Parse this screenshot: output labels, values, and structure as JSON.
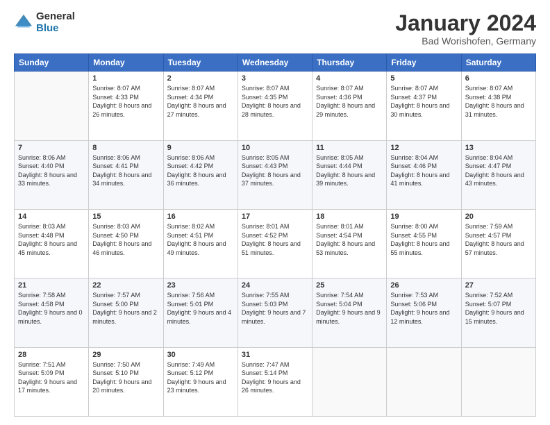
{
  "logo": {
    "general": "General",
    "blue": "Blue"
  },
  "title": "January 2024",
  "location": "Bad Worishofen, Germany",
  "weekdays": [
    "Sunday",
    "Monday",
    "Tuesday",
    "Wednesday",
    "Thursday",
    "Friday",
    "Saturday"
  ],
  "weeks": [
    [
      {
        "day": "",
        "sunrise": "",
        "sunset": "",
        "daylight": ""
      },
      {
        "day": "1",
        "sunrise": "8:07 AM",
        "sunset": "4:33 PM",
        "daylight": "8 hours and 26 minutes."
      },
      {
        "day": "2",
        "sunrise": "8:07 AM",
        "sunset": "4:34 PM",
        "daylight": "8 hours and 27 minutes."
      },
      {
        "day": "3",
        "sunrise": "8:07 AM",
        "sunset": "4:35 PM",
        "daylight": "8 hours and 28 minutes."
      },
      {
        "day": "4",
        "sunrise": "8:07 AM",
        "sunset": "4:36 PM",
        "daylight": "8 hours and 29 minutes."
      },
      {
        "day": "5",
        "sunrise": "8:07 AM",
        "sunset": "4:37 PM",
        "daylight": "8 hours and 30 minutes."
      },
      {
        "day": "6",
        "sunrise": "8:07 AM",
        "sunset": "4:38 PM",
        "daylight": "8 hours and 31 minutes."
      }
    ],
    [
      {
        "day": "7",
        "sunrise": "8:06 AM",
        "sunset": "4:40 PM",
        "daylight": "8 hours and 33 minutes."
      },
      {
        "day": "8",
        "sunrise": "8:06 AM",
        "sunset": "4:41 PM",
        "daylight": "8 hours and 34 minutes."
      },
      {
        "day": "9",
        "sunrise": "8:06 AM",
        "sunset": "4:42 PM",
        "daylight": "8 hours and 36 minutes."
      },
      {
        "day": "10",
        "sunrise": "8:05 AM",
        "sunset": "4:43 PM",
        "daylight": "8 hours and 37 minutes."
      },
      {
        "day": "11",
        "sunrise": "8:05 AM",
        "sunset": "4:44 PM",
        "daylight": "8 hours and 39 minutes."
      },
      {
        "day": "12",
        "sunrise": "8:04 AM",
        "sunset": "4:46 PM",
        "daylight": "8 hours and 41 minutes."
      },
      {
        "day": "13",
        "sunrise": "8:04 AM",
        "sunset": "4:47 PM",
        "daylight": "8 hours and 43 minutes."
      }
    ],
    [
      {
        "day": "14",
        "sunrise": "8:03 AM",
        "sunset": "4:48 PM",
        "daylight": "8 hours and 45 minutes."
      },
      {
        "day": "15",
        "sunrise": "8:03 AM",
        "sunset": "4:50 PM",
        "daylight": "8 hours and 46 minutes."
      },
      {
        "day": "16",
        "sunrise": "8:02 AM",
        "sunset": "4:51 PM",
        "daylight": "8 hours and 49 minutes."
      },
      {
        "day": "17",
        "sunrise": "8:01 AM",
        "sunset": "4:52 PM",
        "daylight": "8 hours and 51 minutes."
      },
      {
        "day": "18",
        "sunrise": "8:01 AM",
        "sunset": "4:54 PM",
        "daylight": "8 hours and 53 minutes."
      },
      {
        "day": "19",
        "sunrise": "8:00 AM",
        "sunset": "4:55 PM",
        "daylight": "8 hours and 55 minutes."
      },
      {
        "day": "20",
        "sunrise": "7:59 AM",
        "sunset": "4:57 PM",
        "daylight": "8 hours and 57 minutes."
      }
    ],
    [
      {
        "day": "21",
        "sunrise": "7:58 AM",
        "sunset": "4:58 PM",
        "daylight": "9 hours and 0 minutes."
      },
      {
        "day": "22",
        "sunrise": "7:57 AM",
        "sunset": "5:00 PM",
        "daylight": "9 hours and 2 minutes."
      },
      {
        "day": "23",
        "sunrise": "7:56 AM",
        "sunset": "5:01 PM",
        "daylight": "9 hours and 4 minutes."
      },
      {
        "day": "24",
        "sunrise": "7:55 AM",
        "sunset": "5:03 PM",
        "daylight": "9 hours and 7 minutes."
      },
      {
        "day": "25",
        "sunrise": "7:54 AM",
        "sunset": "5:04 PM",
        "daylight": "9 hours and 9 minutes."
      },
      {
        "day": "26",
        "sunrise": "7:53 AM",
        "sunset": "5:06 PM",
        "daylight": "9 hours and 12 minutes."
      },
      {
        "day": "27",
        "sunrise": "7:52 AM",
        "sunset": "5:07 PM",
        "daylight": "9 hours and 15 minutes."
      }
    ],
    [
      {
        "day": "28",
        "sunrise": "7:51 AM",
        "sunset": "5:09 PM",
        "daylight": "9 hours and 17 minutes."
      },
      {
        "day": "29",
        "sunrise": "7:50 AM",
        "sunset": "5:10 PM",
        "daylight": "9 hours and 20 minutes."
      },
      {
        "day": "30",
        "sunrise": "7:49 AM",
        "sunset": "5:12 PM",
        "daylight": "9 hours and 23 minutes."
      },
      {
        "day": "31",
        "sunrise": "7:47 AM",
        "sunset": "5:14 PM",
        "daylight": "9 hours and 26 minutes."
      },
      {
        "day": "",
        "sunrise": "",
        "sunset": "",
        "daylight": ""
      },
      {
        "day": "",
        "sunrise": "",
        "sunset": "",
        "daylight": ""
      },
      {
        "day": "",
        "sunrise": "",
        "sunset": "",
        "daylight": ""
      }
    ]
  ]
}
